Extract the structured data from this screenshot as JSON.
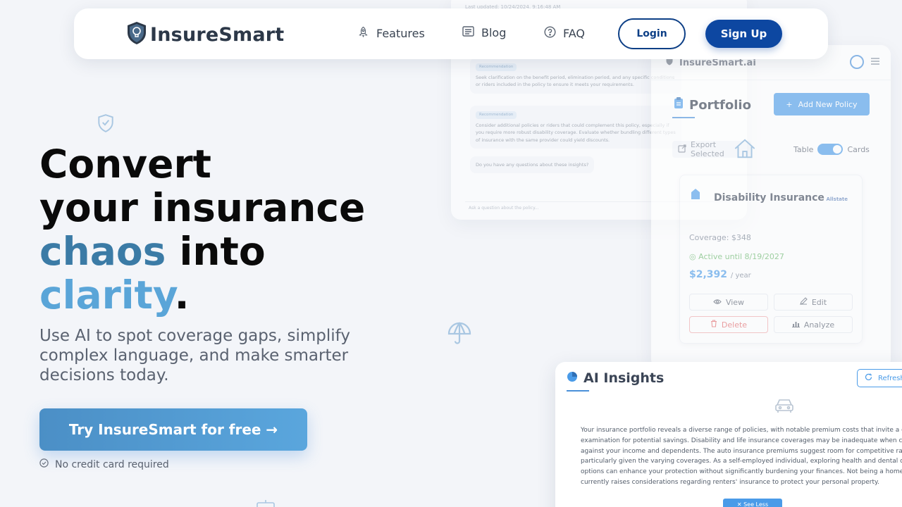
{
  "nav": {
    "brand": "InsureSmart",
    "links": [
      {
        "label": "Features",
        "icon": "rocket-icon"
      },
      {
        "label": "Blog",
        "icon": "newspaper-icon"
      },
      {
        "label": "FAQ",
        "icon": "question-circle-icon"
      }
    ],
    "login": "Login",
    "signup": "Sign Up"
  },
  "hero": {
    "line1": "Convert",
    "line2": "your insurance",
    "line3_accent": "chaos",
    "line3_rest": " into",
    "line4_accent": "clarity",
    "line4_rest": ".",
    "subtitle": "Use AI to spot coverage gaps, simplify complex language, and make smarter decisions today.",
    "cta": "Try InsureSmart for free →",
    "note": "No credit card required"
  },
  "chat_preview": {
    "updated": "Last updated: 10/24/2024, 9:16:48 AM",
    "cards": [
      {
        "tag": "Recommendation",
        "text": "Seek clarification on the benefit period, elimination period, and any specific conditions or riders included in the policy to ensure it meets your requirements."
      },
      {
        "tag": "Recommendation",
        "text": "Consider additional policies or riders that could complement this policy, especially if you require more robust disability coverage. Evaluate whether bundling different types of insurance with the same provider could yield discounts."
      }
    ],
    "question": "Do you have any questions about these insights?",
    "input_placeholder": "Ask a question about the policy..."
  },
  "portfolio": {
    "brand": "InsureSmart.ai",
    "title": "Portfolio",
    "add_button": "Add New Policy",
    "export": "Export Selected",
    "toggle_left": "Table",
    "toggle_right": "Cards",
    "card": {
      "name": "Disability Insurance",
      "provider": "Allstate",
      "coverage": "Coverage: $348",
      "status": "Active until 8/19/2027",
      "price": "$2,392",
      "price_unit": "/ year",
      "actions": [
        "View",
        "Edit",
        "Delete",
        "Analyze"
      ]
    }
  },
  "ai_insights": {
    "title": "AI Insights",
    "refresh": "Refresh",
    "lines": [
      "Your insurance portfolio reveals a diverse range of policies, with notable premium costs that invite a closer",
      "examination for potential savings. Disability and life insurance coverages may be inadequate when considered",
      "against your income and dependents. The auto insurance premiums suggest room for competitive rate shopping,",
      "particularly given the varying coverages. As a self-employed individual, exploring health and dental coverage",
      "options can enhance your protection without significantly burdening your finances. Not being a homeowner",
      "currently raises considerations regarding renters' insurance to protect your personal property."
    ],
    "see_less": "✕ See Less"
  },
  "colors": {
    "brand_navy": "#0d47a1",
    "accent_dark": "#3b7ba6",
    "accent_light": "#5aa5d8"
  }
}
